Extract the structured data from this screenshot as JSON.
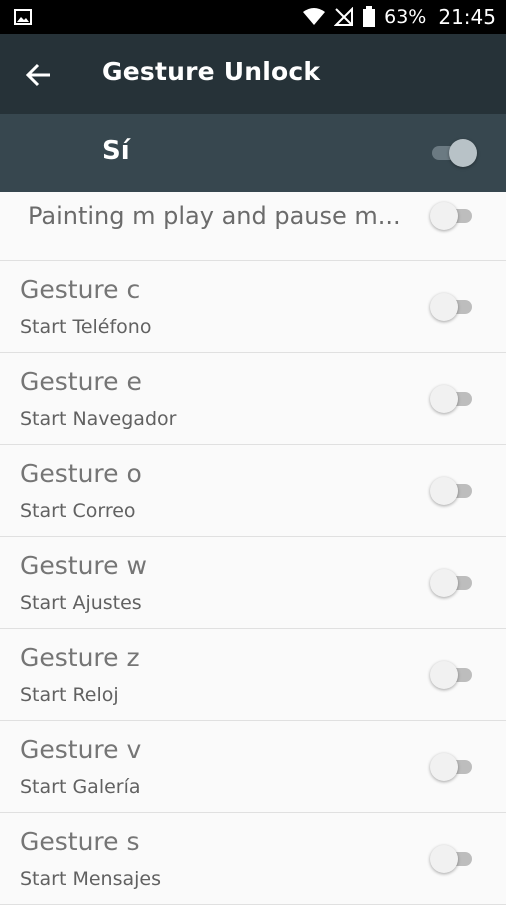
{
  "status_bar": {
    "battery_percent": "63%",
    "time": "21:45"
  },
  "app_bar": {
    "title": "Gesture Unlock"
  },
  "master": {
    "label": "Sí"
  },
  "items": [
    {
      "title": "Painting m play and pause m..."
    },
    {
      "title": "Gesture c",
      "subtitle": "Start Teléfono"
    },
    {
      "title": "Gesture e",
      "subtitle": "Start Navegador"
    },
    {
      "title": "Gesture o",
      "subtitle": "Start Correo"
    },
    {
      "title": "Gesture w",
      "subtitle": "Start Ajustes"
    },
    {
      "title": "Gesture z",
      "subtitle": "Start Reloj"
    },
    {
      "title": "Gesture v",
      "subtitle": "Start Galería"
    },
    {
      "title": "Gesture s",
      "subtitle": "Start Mensajes"
    }
  ],
  "colors": {
    "status_bar": "#000000",
    "app_bar": "#263238",
    "master_row": "#37474f",
    "background": "#fafafa"
  },
  "icons": {
    "status_left": "image-icon",
    "wifi": "wifi-icon",
    "no_signal": "no-signal-icon",
    "battery": "battery-icon",
    "back": "back-arrow-icon"
  }
}
